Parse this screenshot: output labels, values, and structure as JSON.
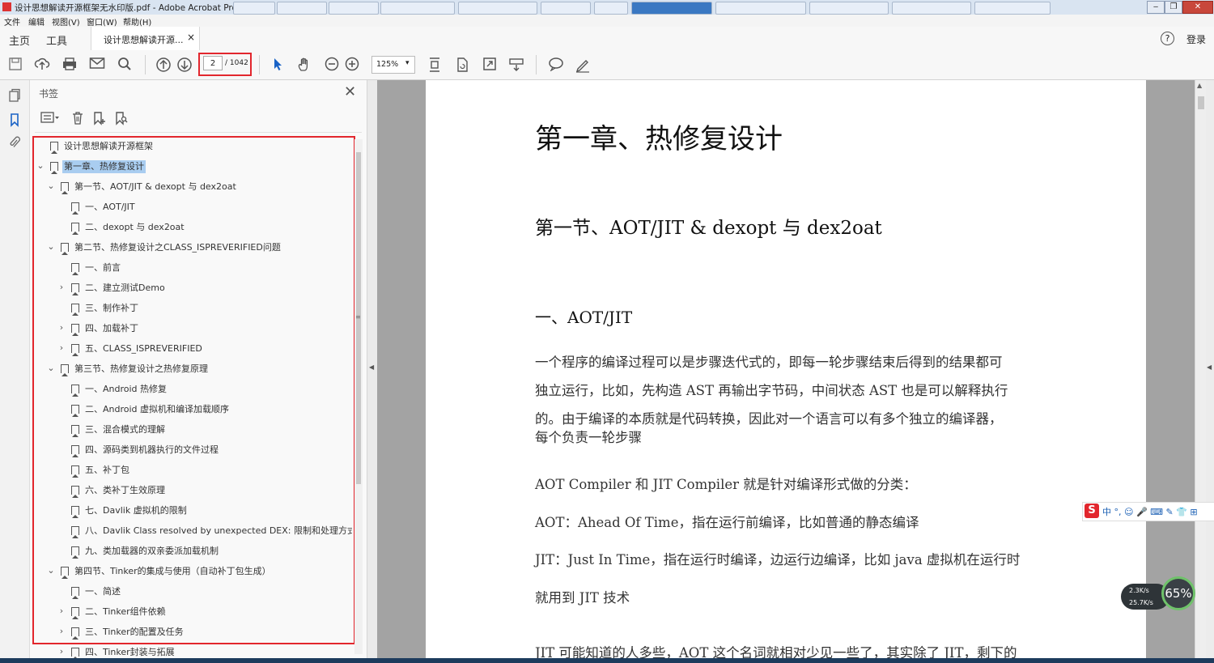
{
  "window": {
    "title": "设计思想解读开源框架无水印版.pdf - Adobe Acrobat Pro DC",
    "controls": [
      "‒",
      "❐",
      "✕"
    ]
  },
  "menu": [
    "文件",
    "编辑",
    "视图(V)",
    "窗口(W)",
    "帮助(H)"
  ],
  "tabs": {
    "home": "主页",
    "tools": "工具",
    "document": "设计思想解读开源...",
    "close": "×",
    "help": "?",
    "login": "登录"
  },
  "toolbar": {
    "current_page": "2",
    "total_pages": "/ 1042",
    "zoom": "125%",
    "zoom_arrow": "▾"
  },
  "bookmarks": {
    "header": "书签",
    "close": "✕",
    "items": [
      {
        "label": "设计思想解读开源框架",
        "chevron": ""
      },
      {
        "label": "第一章、热修复设计",
        "chevron": "⌄"
      },
      {
        "label": "第一节、AOT/JIT & dexopt 与 dex2oat",
        "chevron": "⌄"
      },
      {
        "label": "一、AOT/JIT",
        "chevron": ""
      },
      {
        "label": "二、dexopt 与 dex2oat",
        "chevron": ""
      },
      {
        "label": "第二节、热修复设计之CLASS_ISPREVERIFIED问题",
        "chevron": "⌄"
      },
      {
        "label": "一、前言",
        "chevron": ""
      },
      {
        "label": "二、建立测试Demo",
        "chevron": "›"
      },
      {
        "label": "三、制作补丁",
        "chevron": ""
      },
      {
        "label": "四、加载补丁",
        "chevron": "›"
      },
      {
        "label": "五、CLASS_ISPREVERIFIED",
        "chevron": "›"
      },
      {
        "label": "第三节、热修复设计之热修复原理",
        "chevron": "⌄"
      },
      {
        "label": "一、Android 热修复",
        "chevron": ""
      },
      {
        "label": "二、Android 虚拟机和编译加载顺序",
        "chevron": ""
      },
      {
        "label": "三、混合模式的理解",
        "chevron": ""
      },
      {
        "label": "四、源码类到机器执行的文件过程",
        "chevron": ""
      },
      {
        "label": "五、补丁包",
        "chevron": ""
      },
      {
        "label": "六、类补丁生效原理",
        "chevron": ""
      },
      {
        "label": "七、Davlik 虚拟机的限制",
        "chevron": ""
      },
      {
        "label": "八、Davlik Class resolved by unexpected DEX: 限制和处理方式",
        "chevron": ""
      },
      {
        "label": "九、类加载器的双亲委派加载机制",
        "chevron": ""
      },
      {
        "label": "第四节、Tinker的集成与使用（自动补丁包生成）",
        "chevron": "⌄"
      },
      {
        "label": "一、简述",
        "chevron": ""
      },
      {
        "label": "二、Tinker组件依赖",
        "chevron": "›"
      },
      {
        "label": "三、Tinker的配置及任务",
        "chevron": "›"
      },
      {
        "label": "四、Tinker封装与拓展",
        "chevron": "›"
      }
    ]
  },
  "document": {
    "chapter_title": "第一章、热修复设计",
    "section_title": "第一节、AOT/JIT & dexopt 与 dex2oat",
    "sub_title": "一、AOT/JIT",
    "paragraphs": [
      "一个程序的编译过程可以是步骤迭代式的，即每一轮步骤结束后得到的结果都可",
      "独立运行，比如，先构造 AST 再输出字节码，中间状态 AST 也是可以解释执行",
      "的。由于编译的本质就是代码转换，因此对一个语言可以有多个独立的编译器，",
      "每个负责一轮步骤",
      "AOT Compiler 和 JIT Compiler 就是针对编译形式做的分类：",
      "AOT：Ahead Of Time，指在运行前编译，比如普通的静态编译",
      "JIT：Just In Time，指在运行时编译，边运行边编译，比如 java 虚拟机在运行时",
      "就用到 JIT 技术",
      "JIT 可能知道的人多些，AOT 这个名词就相对少见一些了，其实除了 JIT，剩下的"
    ]
  },
  "ime": {
    "logo": "S",
    "status": "中 °, ☺ 🎤 ⌨ ✎ 👕 ⊞"
  },
  "network": {
    "up": "2.3K/s",
    "down": "25.7K/s",
    "percent": "65%"
  }
}
